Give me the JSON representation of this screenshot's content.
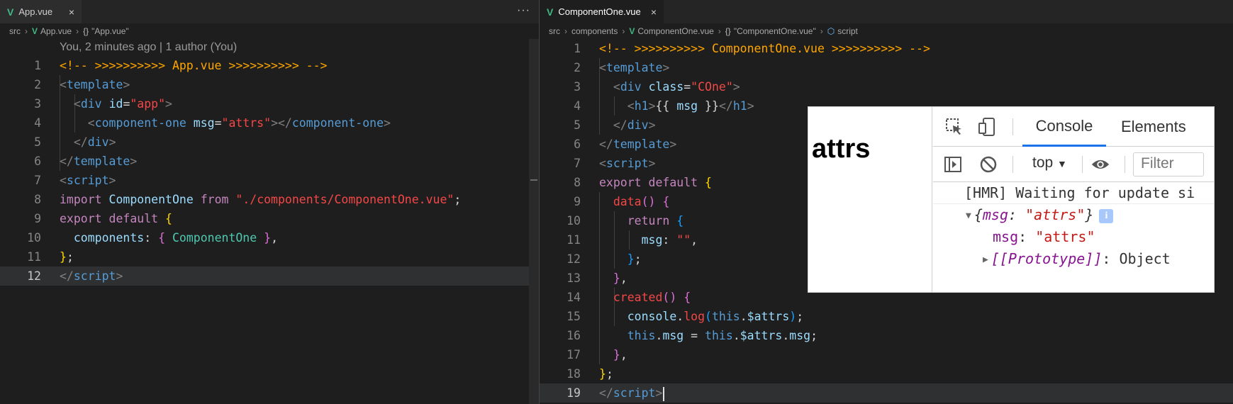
{
  "left": {
    "tab": {
      "label": "App.vue",
      "close": "×"
    },
    "more": "···",
    "breadcrumb": [
      "src",
      "App.vue",
      "\"App.vue\""
    ],
    "codelens": "You, 2 minutes ago | 1 author (You)",
    "line_numbers": [
      "1",
      "2",
      "3",
      "4",
      "5",
      "6",
      "7",
      "8",
      "9",
      "10",
      "11",
      "12"
    ]
  },
  "right": {
    "tab": {
      "label": "ComponentOne.vue",
      "close": "×"
    },
    "breadcrumb": [
      "src",
      "components",
      "ComponentOne.vue",
      "\"ComponentOne.vue\"",
      "script"
    ],
    "line_numbers": [
      "1",
      "2",
      "3",
      "4",
      "5",
      "6",
      "7",
      "8",
      "9",
      "10",
      "11",
      "12",
      "13",
      "14",
      "15",
      "16",
      "17",
      "18",
      "19"
    ]
  },
  "devtools": {
    "page_heading": "attrs",
    "tabs": [
      "Console",
      "Elements"
    ],
    "context": "top",
    "filter_placeholder": "Filter",
    "log_message": "[HMR] Waiting for update si",
    "object_summary": {
      "key": "msg",
      "value": "\"attrs\""
    },
    "object_prop": {
      "key": "msg",
      "value": "\"attrs\""
    },
    "prototype_label": "[[Prototype]]",
    "prototype_value": ": Object"
  },
  "icons": {
    "vue": "vue-icon",
    "braces": "braces-icon",
    "symbol": "cube-icon",
    "inspect": "inspect-icon",
    "device": "device-icon",
    "sidebar": "sidebar-icon",
    "clear": "clear-icon",
    "eye": "eye-icon"
  },
  "colors": {
    "editor_bg": "#1e1e1e",
    "comment": "#ffa500",
    "tag": "#569cd6",
    "string": "#f44747",
    "keyword": "#c586c0",
    "class": "#4ec9b0",
    "devtools_accent": "#1a73e8"
  }
}
